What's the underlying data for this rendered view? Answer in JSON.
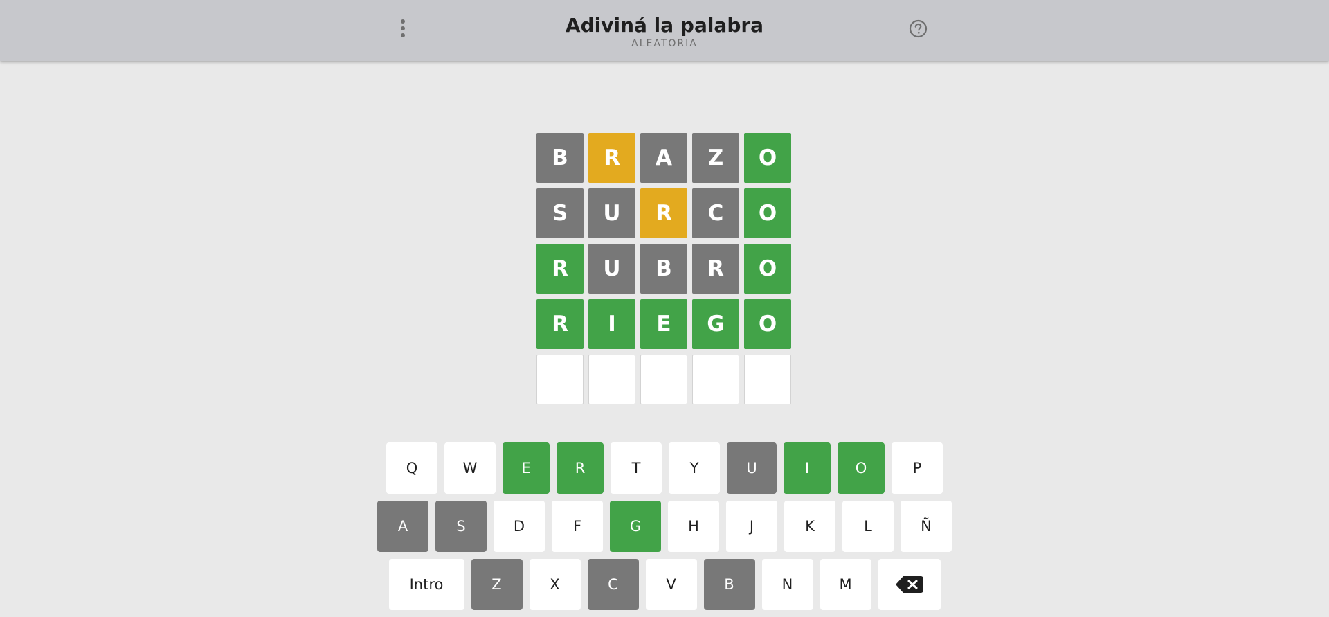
{
  "header": {
    "title": "Adiviná la palabra",
    "subtitle": "ALEATORIA",
    "menu_icon": "vertical-dots-icon",
    "help_icon": "question-circle-icon"
  },
  "colors": {
    "absent": "#787878",
    "present": "#e3aa1f",
    "correct": "#42a348",
    "empty": "#ffffff",
    "background": "#e9e9e9",
    "header": "#c7c8cc"
  },
  "board": {
    "rows": [
      [
        {
          "letter": "B",
          "state": "absent"
        },
        {
          "letter": "R",
          "state": "present"
        },
        {
          "letter": "A",
          "state": "absent"
        },
        {
          "letter": "Z",
          "state": "absent"
        },
        {
          "letter": "O",
          "state": "correct"
        }
      ],
      [
        {
          "letter": "S",
          "state": "absent"
        },
        {
          "letter": "U",
          "state": "absent"
        },
        {
          "letter": "R",
          "state": "present"
        },
        {
          "letter": "C",
          "state": "absent"
        },
        {
          "letter": "O",
          "state": "correct"
        }
      ],
      [
        {
          "letter": "R",
          "state": "correct"
        },
        {
          "letter": "U",
          "state": "absent"
        },
        {
          "letter": "B",
          "state": "absent"
        },
        {
          "letter": "R",
          "state": "absent"
        },
        {
          "letter": "O",
          "state": "correct"
        }
      ],
      [
        {
          "letter": "R",
          "state": "correct"
        },
        {
          "letter": "I",
          "state": "correct"
        },
        {
          "letter": "E",
          "state": "correct"
        },
        {
          "letter": "G",
          "state": "correct"
        },
        {
          "letter": "O",
          "state": "correct"
        }
      ],
      [
        {
          "letter": "",
          "state": "empty"
        },
        {
          "letter": "",
          "state": "empty"
        },
        {
          "letter": "",
          "state": "empty"
        },
        {
          "letter": "",
          "state": "empty"
        },
        {
          "letter": "",
          "state": "empty"
        }
      ]
    ]
  },
  "keyboard": {
    "rows": [
      [
        {
          "key": "Q",
          "state": "default"
        },
        {
          "key": "W",
          "state": "default"
        },
        {
          "key": "E",
          "state": "correct"
        },
        {
          "key": "R",
          "state": "correct"
        },
        {
          "key": "T",
          "state": "default"
        },
        {
          "key": "Y",
          "state": "default"
        },
        {
          "key": "U",
          "state": "absent"
        },
        {
          "key": "I",
          "state": "correct"
        },
        {
          "key": "O",
          "state": "correct"
        },
        {
          "key": "P",
          "state": "default"
        }
      ],
      [
        {
          "key": "A",
          "state": "absent"
        },
        {
          "key": "S",
          "state": "absent"
        },
        {
          "key": "D",
          "state": "default"
        },
        {
          "key": "F",
          "state": "default"
        },
        {
          "key": "G",
          "state": "correct"
        },
        {
          "key": "H",
          "state": "default"
        },
        {
          "key": "J",
          "state": "default"
        },
        {
          "key": "K",
          "state": "default"
        },
        {
          "key": "L",
          "state": "default"
        },
        {
          "key": "Ñ",
          "state": "default"
        }
      ],
      [
        {
          "key": "Intro",
          "state": "default",
          "type": "enter"
        },
        {
          "key": "Z",
          "state": "absent"
        },
        {
          "key": "X",
          "state": "default"
        },
        {
          "key": "C",
          "state": "absent"
        },
        {
          "key": "V",
          "state": "default"
        },
        {
          "key": "B",
          "state": "absent"
        },
        {
          "key": "N",
          "state": "default"
        },
        {
          "key": "M",
          "state": "default"
        },
        {
          "key": "",
          "state": "default",
          "type": "backspace",
          "icon": "backspace-icon"
        }
      ]
    ]
  }
}
